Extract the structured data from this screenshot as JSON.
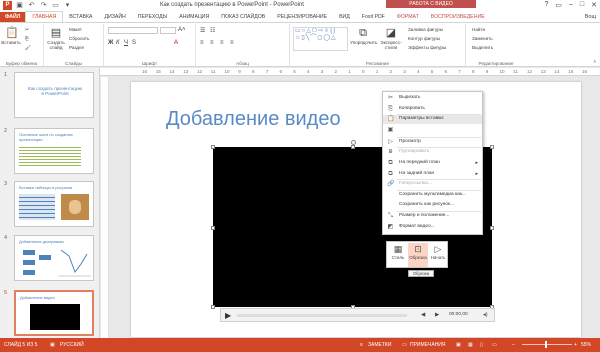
{
  "window": {
    "title": "Как создать презентацию в PowerPoint - PowerPoint",
    "context_group": "РАБОТА С ВИДЕО",
    "user": "Вощ"
  },
  "tabs": [
    {
      "label": "ФАЙЛ"
    },
    {
      "label": "ГЛАВНАЯ"
    },
    {
      "label": "ВСТАВКА"
    },
    {
      "label": "ДИЗАЙН"
    },
    {
      "label": "ПЕРЕХОДЫ"
    },
    {
      "label": "АНИМАЦИЯ"
    },
    {
      "label": "ПОКАЗ СЛАЙДОВ"
    },
    {
      "label": "РЕЦЕНЗИРОВАНИЕ"
    },
    {
      "label": "ВИД"
    },
    {
      "label": "Foxit PDF"
    },
    {
      "label": "ФОРМАТ"
    },
    {
      "label": "ВОСПРОИЗВЕДЕНИЕ"
    }
  ],
  "ribbon": {
    "clipboard": {
      "paste": "Вставить",
      "label": "Буфер обмена"
    },
    "slides": {
      "new_slide": "Создать слайд",
      "layout": "Макет",
      "reset": "Сбросить",
      "section": "Раздел",
      "label": "Слайды"
    },
    "font": {
      "label": "Шрифт"
    },
    "paragraph": {
      "label": "Абзац"
    },
    "drawing": {
      "arrange": "Упорядочить",
      "quick_styles": "Экспресс-стили",
      "fill": "Заливка фигуры",
      "outline": "Контур фигуры",
      "effects": "Эффекты фигуры",
      "label": "Рисование"
    },
    "editing": {
      "find": "Найти",
      "replace": "Заменить",
      "select": "Выделить",
      "label": "Редактирование"
    }
  },
  "ruler": [
    "16",
    "15",
    "14",
    "13",
    "12",
    "11",
    "10",
    "9",
    "8",
    "7",
    "6",
    "5",
    "4",
    "3",
    "2",
    "1",
    "0",
    "1",
    "2",
    "3",
    "4",
    "5",
    "6",
    "7",
    "8",
    "9",
    "10",
    "11",
    "12",
    "13",
    "14",
    "15",
    "16"
  ],
  "slides_pane": [
    {
      "num": "1",
      "title": "Как создать презентацию в PowerPoint"
    },
    {
      "num": "2",
      "title": "Основные шаги по созданию презентации"
    },
    {
      "num": "3",
      "title": "Вставка таблицы и рисунков"
    },
    {
      "num": "4",
      "title": "Добавление диаграммы"
    },
    {
      "num": "5",
      "title": "Добавление видео"
    }
  ],
  "slide": {
    "title": "Добавление видео"
  },
  "player": {
    "time": "00:00,00"
  },
  "context_menu": [
    {
      "label": "Вырезать",
      "icon": "scissors-icon",
      "enabled": true
    },
    {
      "label": "Копировать",
      "icon": "copy-icon",
      "enabled": true
    },
    {
      "label": "Параметры вставки:",
      "icon": "paste-icon",
      "enabled": true,
      "highlight": true
    },
    {
      "label": "",
      "icon": "paste-option-icon",
      "enabled": true
    },
    {
      "label": "Просмотр",
      "icon": "play-icon",
      "enabled": true
    },
    {
      "label": "Группировать",
      "icon": "group-icon",
      "enabled": false
    },
    {
      "label": "На передний план",
      "icon": "bring-front-icon",
      "enabled": true,
      "submenu": true
    },
    {
      "label": "На задний план",
      "icon": "send-back-icon",
      "enabled": true,
      "submenu": true
    },
    {
      "label": "Гиперссылка...",
      "icon": "link-icon",
      "enabled": false
    },
    {
      "label": "Сохранить мультимедиа как...",
      "icon": "",
      "enabled": true
    },
    {
      "label": "Сохранить как рисунок...",
      "icon": "",
      "enabled": true
    },
    {
      "label": "Размер и положение...",
      "icon": "size-icon",
      "enabled": true
    },
    {
      "label": "Формат видео...",
      "icon": "format-icon",
      "enabled": true
    }
  ],
  "mini_toolbar": {
    "style": "Стиль",
    "crop": "Обрезка",
    "start": "Начать",
    "tooltip": "Обрезка"
  },
  "status": {
    "slide": "СЛАЙД 5 ИЗ 5",
    "lang": "РУССКИЙ",
    "notes": "ЗАМЕТКИ",
    "comments": "ПРИМЕЧАНИЯ",
    "zoom": "55%"
  },
  "colors": {
    "accent": "#d24726",
    "title_blue": "#5a8ac6",
    "context_red": "#c0504d"
  }
}
